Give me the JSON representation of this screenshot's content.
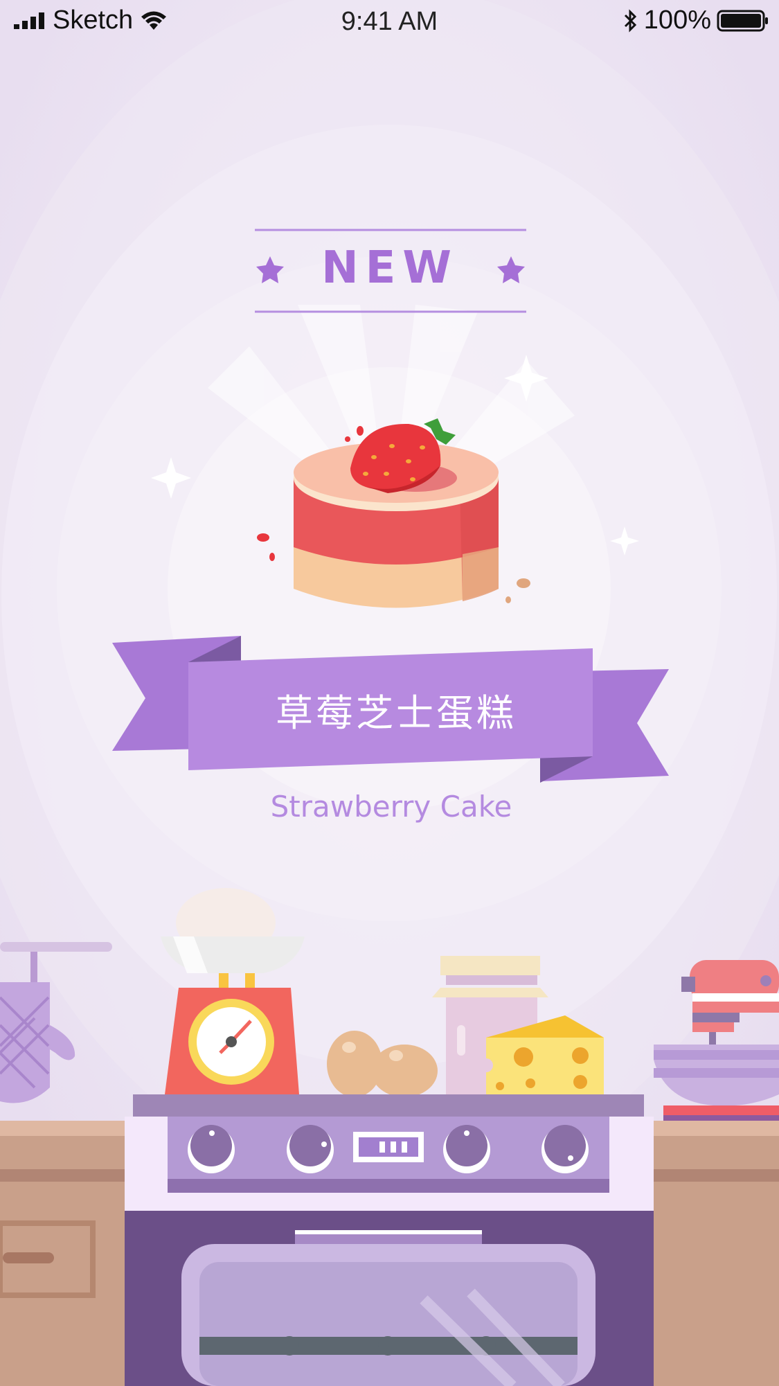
{
  "status_bar": {
    "carrier": "Sketch",
    "time": "9:41 AM",
    "battery_percent": "100%"
  },
  "badge": {
    "label": "NEW"
  },
  "product": {
    "name_cn": "草莓芝士蛋糕",
    "name_en": "Strawberry Cake"
  },
  "colors": {
    "background": "#ece4f1",
    "accent": "#a56fd6",
    "ribbon": "#b78ae0",
    "oven": "#6b4f88"
  },
  "icons": [
    "signal-icon",
    "wifi-icon",
    "bluetooth-icon",
    "battery-icon",
    "star-icon",
    "sparkle-icon"
  ]
}
